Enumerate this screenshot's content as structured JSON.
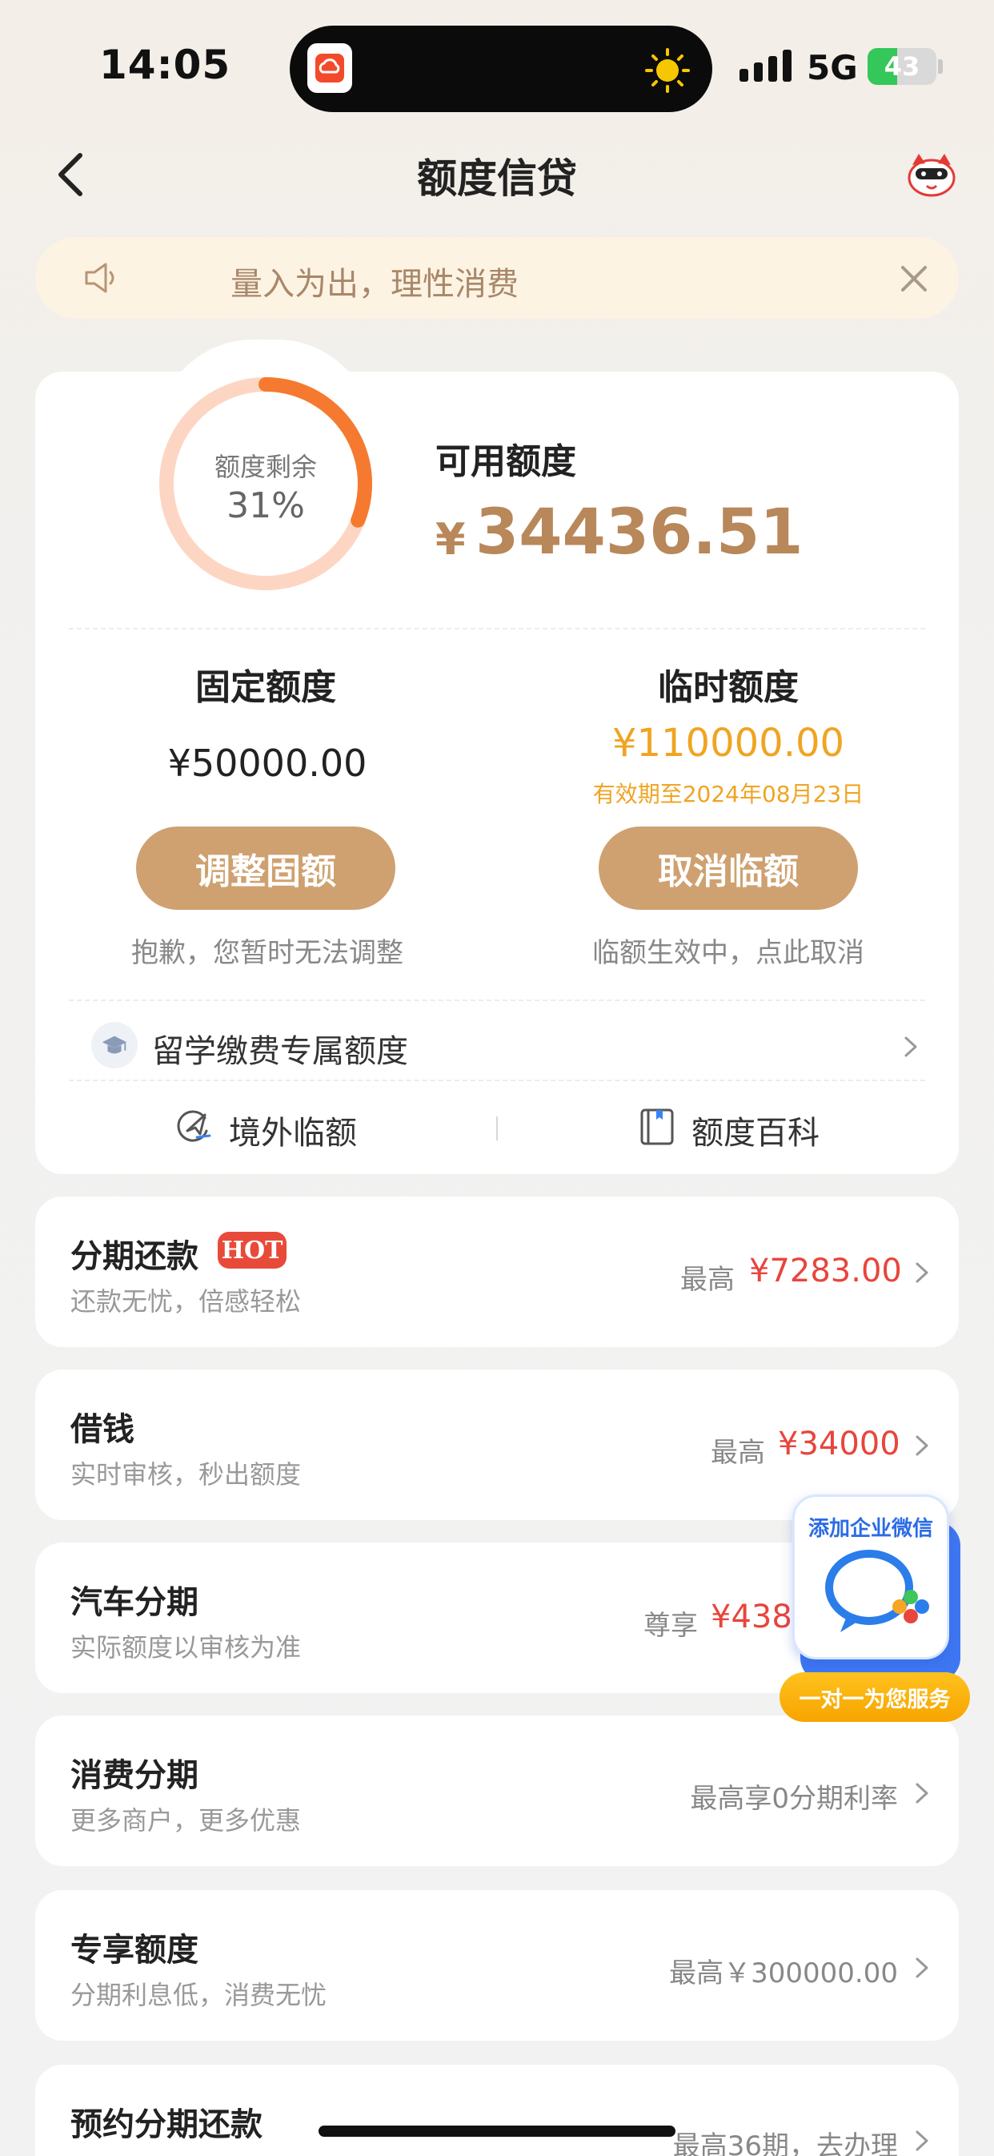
{
  "status_bar": {
    "time": "14:05",
    "network": "5G",
    "battery_level": "43",
    "battery_fraction": 0.43
  },
  "nav": {
    "title": "额度信贷"
  },
  "notice": {
    "text": "量入为出，理性消费"
  },
  "credit": {
    "ring_label": "额度剩余",
    "ring_percent_text": "31%",
    "ring_fraction": 0.31,
    "available_label": "可用额度",
    "currency": "¥",
    "available_amount": "34436.51",
    "fixed": {
      "title": "固定额度",
      "amount": "¥50000.00",
      "button": "调整固额",
      "note": "抱歉，您暂时无法调整"
    },
    "temporary": {
      "title": "临时额度",
      "amount": "¥110000.00",
      "valid": "有效期至2024年08月23日",
      "button": "取消临额",
      "note": "临额生效中，点此取消"
    },
    "study_label": "留学缴费专属额度",
    "tools": [
      {
        "label": "境外临额"
      },
      {
        "label": "额度百科"
      }
    ]
  },
  "list": [
    {
      "title": "分期还款",
      "badge": "HOT",
      "subtitle": "还款无忧，倍感轻松",
      "prefix": "最高",
      "value": "¥7283.00"
    },
    {
      "title": "借钱",
      "subtitle": "实时审核，秒出额度",
      "prefix": "最高",
      "value": "¥34000"
    },
    {
      "title": "汽车分期",
      "subtitle": "实际额度以审核为准",
      "prefix": "尊享",
      "value": "¥438"
    },
    {
      "title": "消费分期",
      "subtitle": "更多商户，更多优惠",
      "right_text": "最高享0分期利率"
    },
    {
      "title": "专享额度",
      "subtitle": "分期利息低，消费无忧",
      "right_text": "最高￥300000.00"
    },
    {
      "title": "预约分期还款",
      "right_text": "最高36期，去办理"
    }
  ],
  "float_widget": {
    "title": "添加企业微信",
    "pill": "一对一为您服务"
  },
  "colors": {
    "accent_gold": "#cfa170",
    "amount_gold": "#b8875a",
    "warning_orange": "#f0a422",
    "price_red": "#e8453c",
    "ring_orange": "#f57a30",
    "ring_track": "#fdd6c3"
  }
}
